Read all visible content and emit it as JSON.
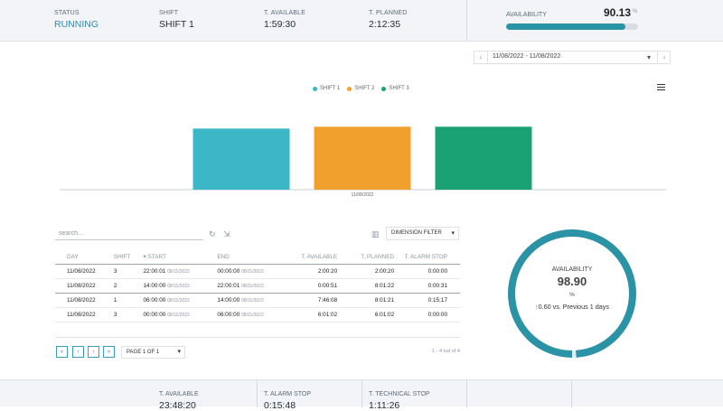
{
  "topbar": {
    "cells": [
      {
        "label": "STATUS",
        "value": "RUNNING"
      },
      {
        "label": "SHIFT",
        "value": "SHIFT 1"
      },
      {
        "label": "T. AVAILABLE",
        "value": "1:59:30"
      },
      {
        "label": "T. PLANNED",
        "value": "2:12:35"
      }
    ],
    "availability": {
      "label": "AVAILABILITY",
      "value": "90.13",
      "unit": "%",
      "progress": 0.9013
    },
    "accent_color": "#2b93a6",
    "status_color": "#2b8fb0"
  },
  "date_range": {
    "text": "11/08/2022 - 11/08/2022",
    "prev_icon": "chevron-left-icon",
    "next_icon": "chevron-right-icon"
  },
  "chart_data": {
    "type": "bar",
    "categories": [
      "11/08/2022"
    ],
    "series": [
      {
        "name": "SHIFT 1",
        "color": "#3bb7c8",
        "values": [
          1
        ]
      },
      {
        "name": "SHIFT 2",
        "color": "#f1a02d",
        "values": [
          1.03
        ]
      },
      {
        "name": "SHIFT 3",
        "color": "#1aa274",
        "values": [
          1.03
        ]
      }
    ],
    "ylim": [
      0,
      1.3
    ],
    "legend_position": "top-center",
    "grid": false
  },
  "table": {
    "search_placeholder": "search...",
    "dimension_filter": "DIMENSION FILTER",
    "columns": [
      "DAY",
      "SHIFT",
      "START",
      "END",
      "T. AVAILABLE",
      "T. PLANNED",
      "T. ALARM STOP"
    ],
    "sort_indicator": "▾",
    "rows": [
      {
        "day": "11/08/2022",
        "shift": "3",
        "start": "22:00:01",
        "start_date": "08/11/2022",
        "end": "00:00:00",
        "end_date": "08/11/2022",
        "t_available": "2:00:20",
        "t_planned": "2:00:20",
        "t_alarm": "0:00:00"
      },
      {
        "day": "11/08/2022",
        "shift": "2",
        "start": "14:00:00",
        "start_date": "08/11/2022",
        "end": "22:00:01",
        "end_date": "08/11/2022",
        "t_available": "0:00:51",
        "t_planned": "8:01:22",
        "t_alarm": "0:00:31"
      },
      {
        "day": "11/08/2022",
        "shift": "1",
        "start": "06:00:00",
        "start_date": "08/11/2022",
        "end": "14:00:00",
        "end_date": "08/11/2022",
        "t_available": "7:46:08",
        "t_planned": "8:01:21",
        "t_alarm": "0:15:17"
      },
      {
        "day": "11/08/2022",
        "shift": "3",
        "start": "00:00:00",
        "start_date": "08/11/2022",
        "end": "06:00:00",
        "end_date": "08/11/2022",
        "t_available": "6:01:02",
        "t_planned": "6:01:02",
        "t_alarm": "0:00:00"
      }
    ],
    "pagination": {
      "first": "«",
      "prev": "‹",
      "next": "›",
      "last": "»",
      "page_label": "PAGE 1 OF 1",
      "count": "1 - 4 out of 4"
    }
  },
  "gauge": {
    "label": "AVAILABILITY",
    "value": "98.90",
    "unit": "%",
    "fraction": 0.989,
    "compare": "0.60 vs. Previous 1 days",
    "arrow": "↑",
    "color": "#2b93a6"
  },
  "bottombar": {
    "cells": [
      {
        "label": "T. AVAILABLE",
        "value": "23:48:20"
      },
      {
        "label": "T. ALARM STOP",
        "value": "0:15:48"
      },
      {
        "label": "T. TECHNICAL STOP",
        "value": "1:11:26"
      }
    ]
  }
}
